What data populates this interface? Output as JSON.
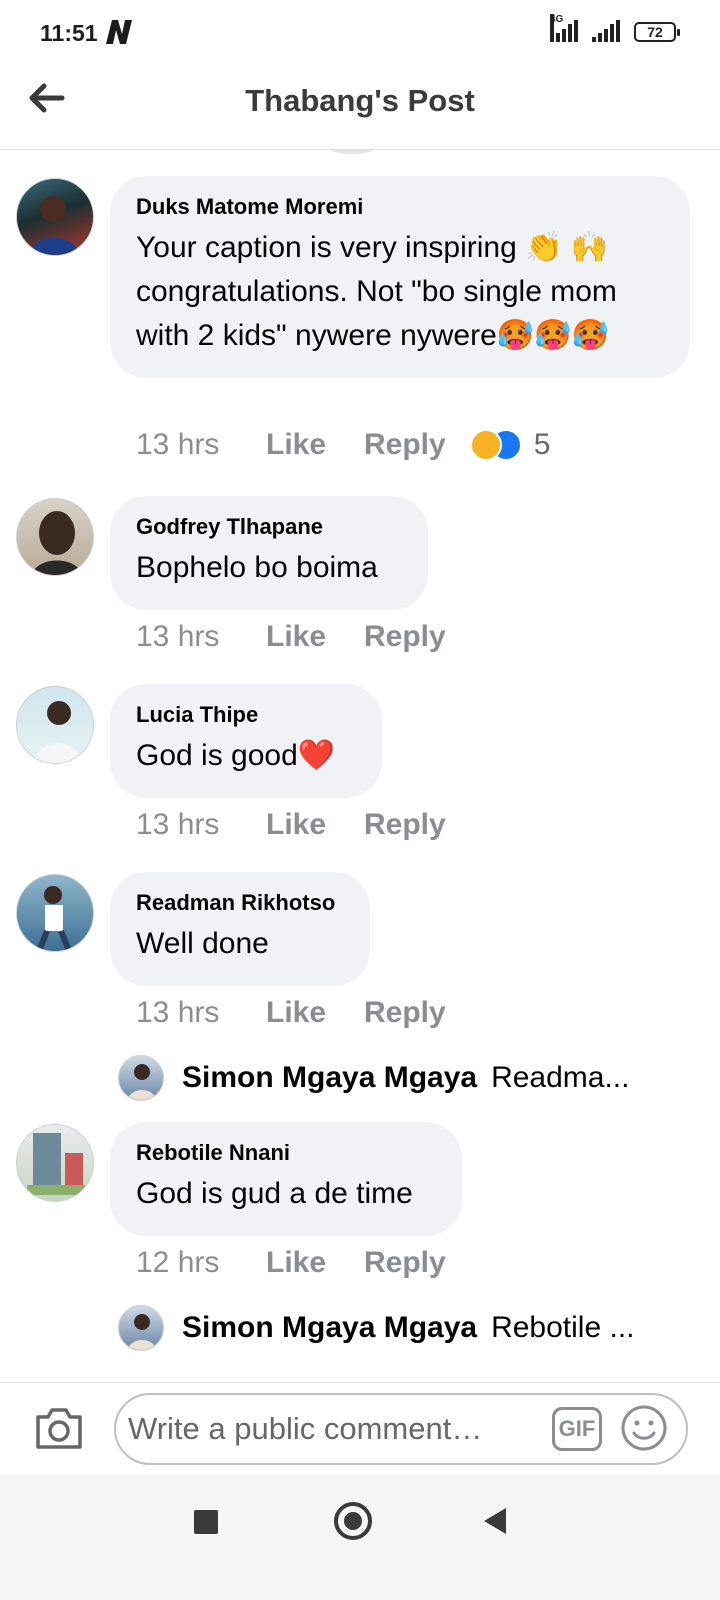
{
  "status_bar": {
    "time": "11:51",
    "network": "4G",
    "battery": "72"
  },
  "header": {
    "title": "Thabang's Post",
    "back_icon": "arrow-left-icon"
  },
  "comments": [
    {
      "author": "Duks Matome Moremi",
      "text": "Your caption is very inspiring 👏 🙌 congratulations. Not \"bo single mom with 2 kids\" nywere nywere🥵🥵🥵",
      "time": "13 hrs",
      "like_label": "Like",
      "reply_label": "Reply",
      "reactions": [
        "haha",
        "like"
      ],
      "reaction_count": "5"
    },
    {
      "author": "Godfrey Tlhapane",
      "text": "Bophelo bo boima",
      "time": "13 hrs",
      "like_label": "Like",
      "reply_label": "Reply"
    },
    {
      "author": "Lucia Thipe",
      "text": "God is good❤️",
      "time": "13 hrs",
      "like_label": "Like",
      "reply_label": "Reply"
    },
    {
      "author": "Readman Rikhotso",
      "text": "Well done",
      "time": "13 hrs",
      "like_label": "Like",
      "reply_label": "Reply",
      "reply_preview": {
        "author": "Simon Mgaya Mgaya",
        "snippet": "Readma..."
      }
    },
    {
      "author": "Rebotile Nnani",
      "text": "God is gud a de time",
      "time": "12 hrs",
      "like_label": "Like",
      "reply_label": "Reply",
      "reply_preview": {
        "author": "Simon Mgaya Mgaya",
        "snippet": "Rebotile ..."
      }
    }
  ],
  "composer": {
    "placeholder": "Write a public comment…",
    "gif_label": "GIF",
    "camera_icon": "camera-icon",
    "emoji_icon": "smiley-icon"
  },
  "colors": {
    "bubble": "#f0f2f5",
    "meta_text": "#8a8d91",
    "like_blue": "#1877f2",
    "haha_yellow": "#f7b125"
  }
}
